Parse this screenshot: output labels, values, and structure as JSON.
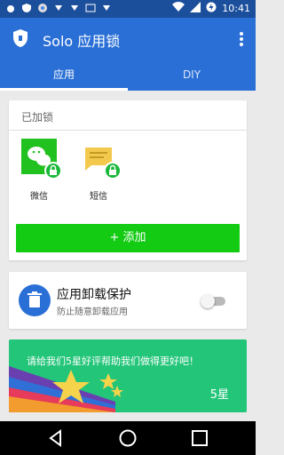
{
  "status_bar": {
    "time": "10:41"
  },
  "app_bar": {
    "title": "Solo 应用锁"
  },
  "tabs": [
    {
      "label": "应用"
    },
    {
      "label": "DIY"
    }
  ],
  "locked_section": {
    "title": "已加锁",
    "apps": [
      {
        "label": "微信",
        "icon": "wechat-icon"
      },
      {
        "label": "短信",
        "icon": "sms-icon"
      }
    ],
    "add_button": "+ 添加"
  },
  "uninstall_protect": {
    "title": "应用卸载保护",
    "subtitle": "防止随意卸载应用",
    "enabled": false
  },
  "rate_banner": {
    "text": "请给我们5星好评帮助我们做得更好吧！",
    "stars_label": "5星"
  },
  "colors": {
    "primary": "#2a6fd6",
    "status_bar": "#1b4f9c",
    "accent_green": "#12cb12",
    "banner_green": "#23c579"
  }
}
